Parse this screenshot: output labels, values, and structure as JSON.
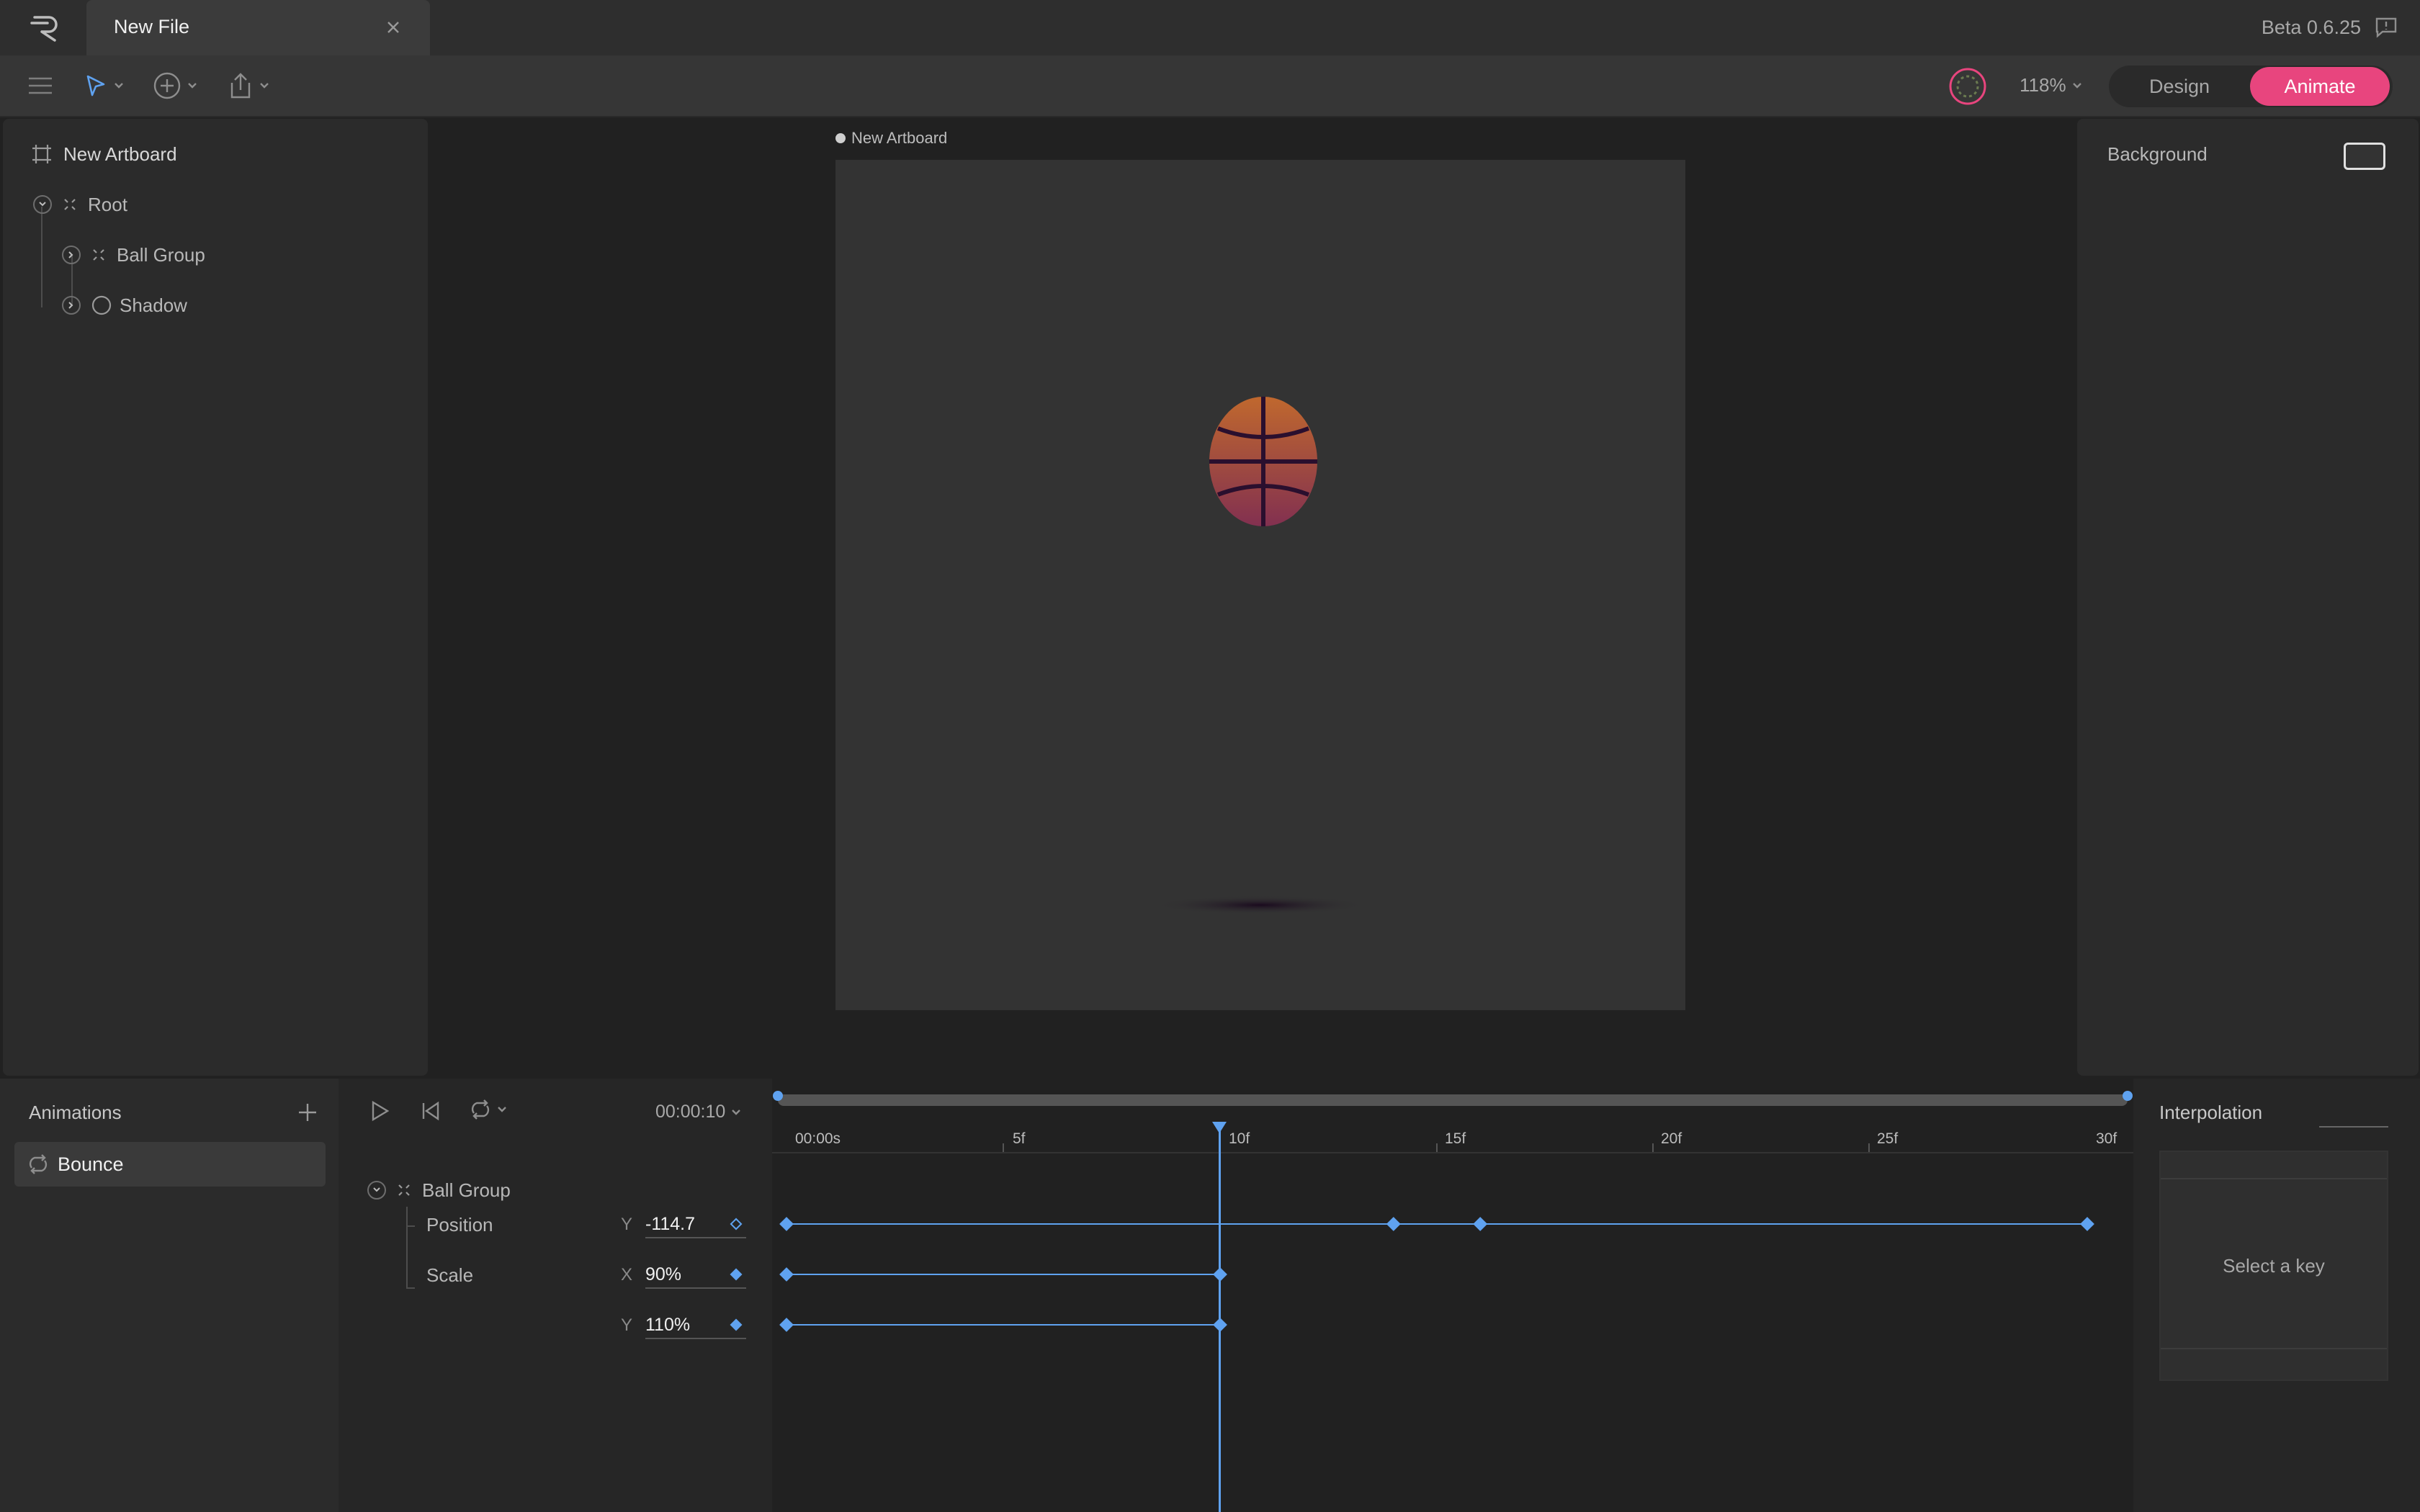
{
  "app": {
    "logo": "rive-logo",
    "version": "Beta 0.6.25"
  },
  "tab": {
    "title": "New File"
  },
  "toolbar": {
    "zoom": "118%",
    "modes": {
      "design": "Design",
      "animate": "Animate",
      "active": "Animate"
    },
    "accent": "#e8457e"
  },
  "hierarchy": {
    "artboard": "New Artboard",
    "items": [
      {
        "label": "Root",
        "icon": "group-icon",
        "expanded": true
      },
      {
        "label": "Ball Group",
        "icon": "group-icon",
        "expanded": false
      },
      {
        "label": "Shadow",
        "icon": "ellipse-icon",
        "expanded": false
      }
    ]
  },
  "canvas": {
    "artboard_label": "New Artboard"
  },
  "inspector": {
    "background_label": "Background"
  },
  "animations": {
    "title": "Animations",
    "items": [
      {
        "label": "Bounce",
        "icon": "loop-icon",
        "selected": true
      }
    ]
  },
  "timeline": {
    "current_time": "00:00:10",
    "ticks": [
      "00:00s",
      "5f",
      "10f",
      "15f",
      "20f",
      "25f",
      "30f"
    ],
    "playhead_frame": 10,
    "group": "Ball Group",
    "properties": [
      {
        "name": "Position",
        "axis": "Y",
        "value": "-114.7",
        "key_state": "hollow",
        "keyframes": [
          0,
          14,
          16,
          30
        ]
      },
      {
        "name": "Scale",
        "axis": "X",
        "value": "90%",
        "key_state": "solid",
        "keyframes": [
          0,
          10
        ]
      },
      {
        "name": "",
        "axis": "Y",
        "value": "110%",
        "key_state": "solid",
        "keyframes": [
          0,
          10
        ]
      }
    ],
    "key_color": "#5fa2f0"
  },
  "interpolation": {
    "title": "Interpolation",
    "empty_text": "Select a key"
  }
}
